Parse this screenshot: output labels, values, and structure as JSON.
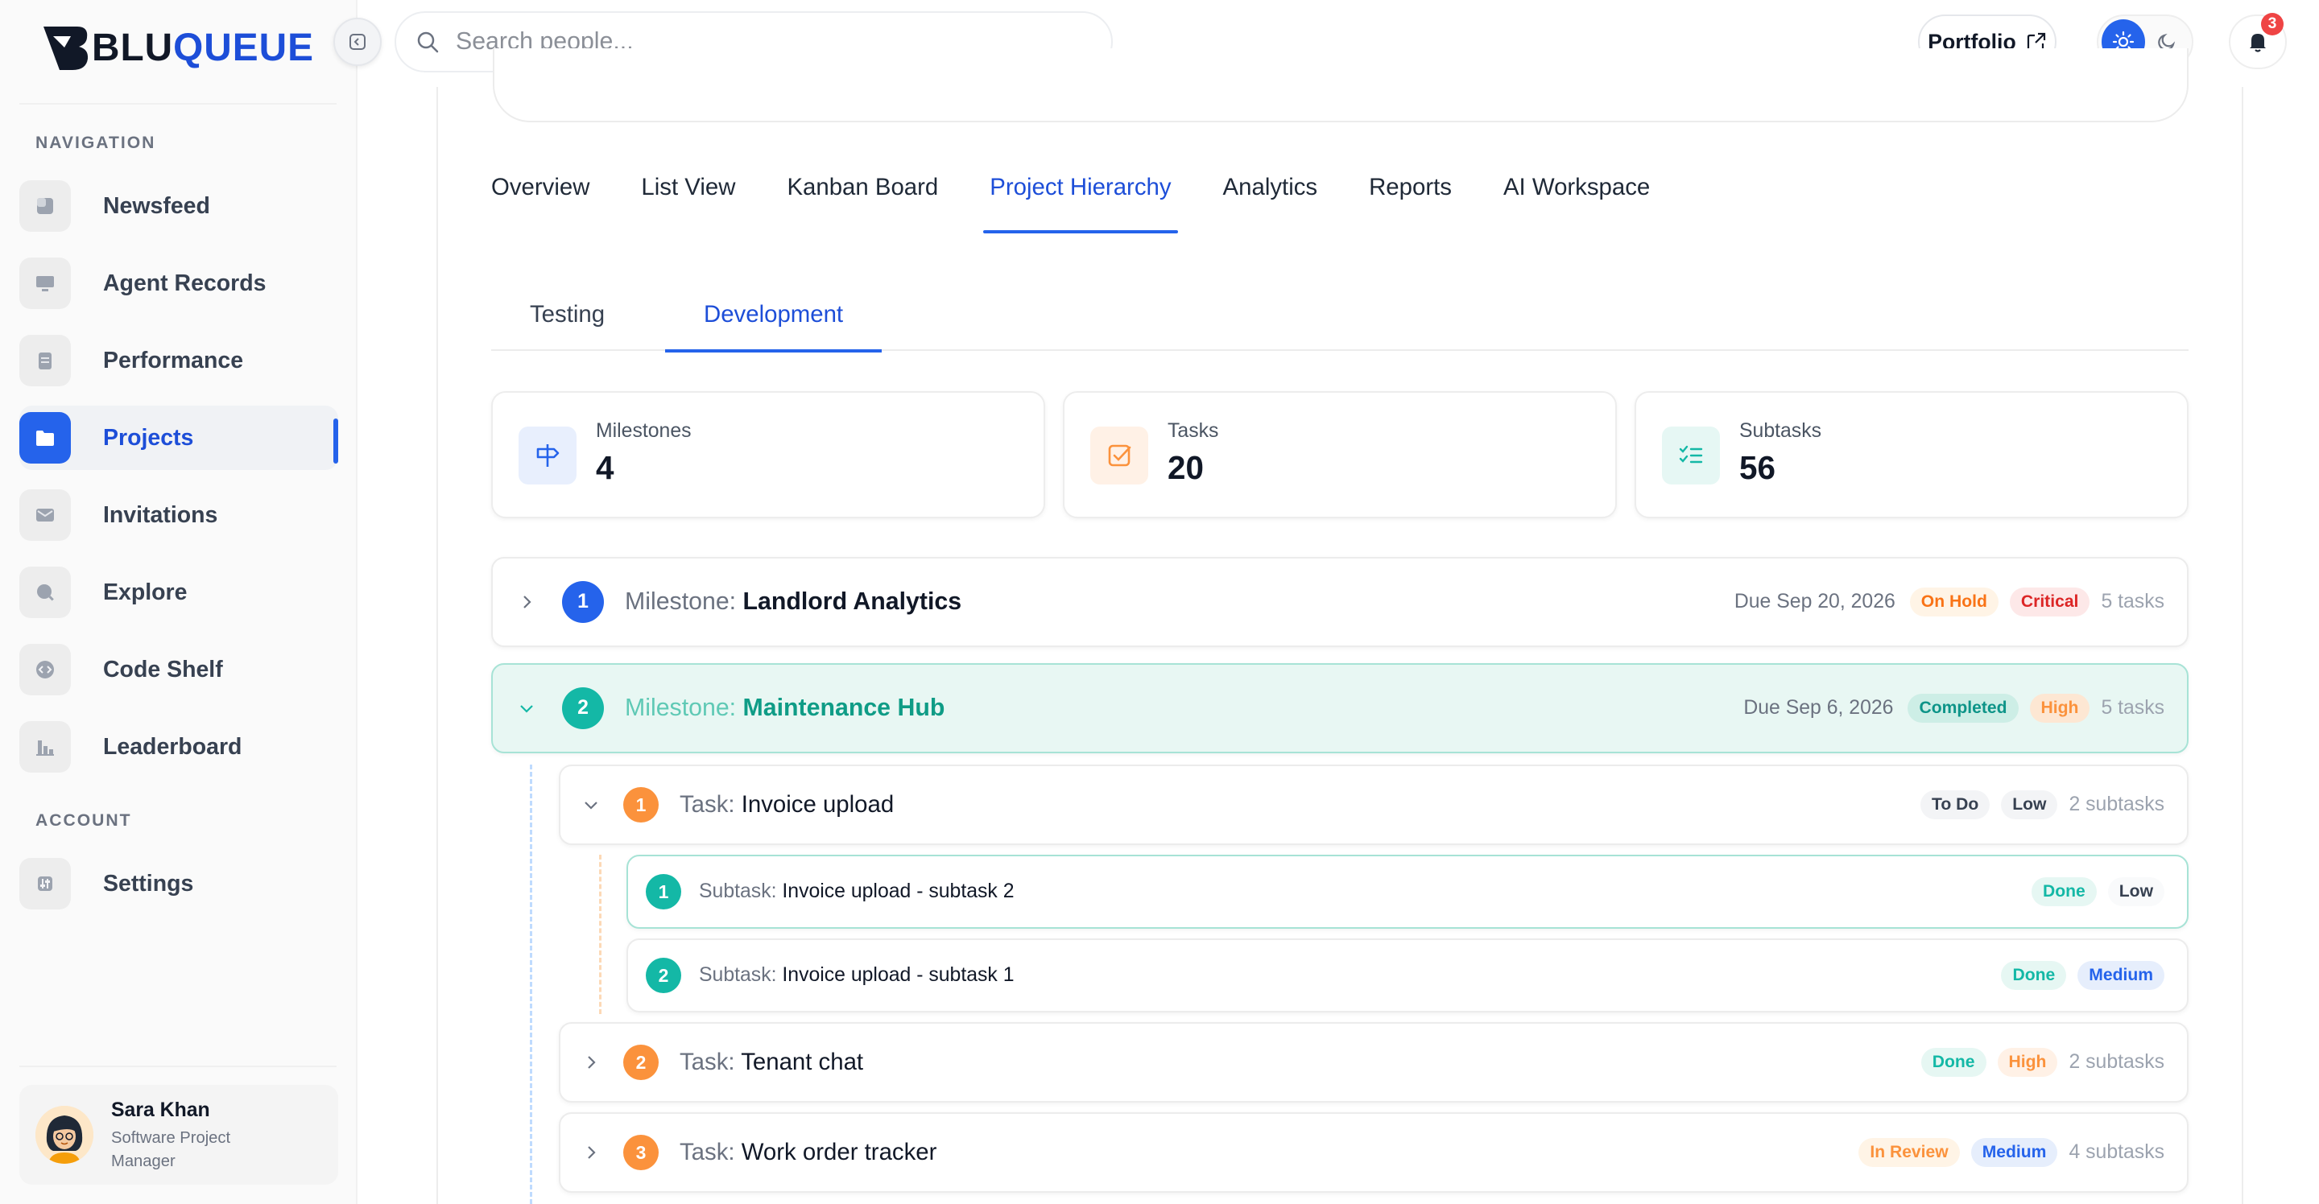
{
  "brand": {
    "logo_text_dark": "BLU",
    "logo_text_blue": "QUEUE",
    "logo_mark_letter": "B"
  },
  "sidebar": {
    "nav_label": "NAVIGATION",
    "account_label": "ACCOUNT",
    "items": [
      {
        "label": "Newsfeed",
        "icon": "newsfeed-icon"
      },
      {
        "label": "Agent Records",
        "icon": "monitor-icon"
      },
      {
        "label": "Performance",
        "icon": "clipboard-icon"
      },
      {
        "label": "Projects",
        "icon": "folder-icon",
        "active": true
      },
      {
        "label": "Invitations",
        "icon": "mail-icon"
      },
      {
        "label": "Explore",
        "icon": "search-icon"
      },
      {
        "label": "Code Shelf",
        "icon": "code-icon"
      },
      {
        "label": "Leaderboard",
        "icon": "bar-chart-icon"
      }
    ],
    "account_items": [
      {
        "label": "Settings",
        "icon": "sliders-icon"
      }
    ]
  },
  "user": {
    "name": "Sara Khan",
    "role": "Software Project Manager"
  },
  "search": {
    "placeholder": "Search people..."
  },
  "header": {
    "portfolio_label": "Portfolio",
    "notification_count": "3"
  },
  "tabs": [
    "Overview",
    "List View",
    "Kanban Board",
    "Project Hierarchy",
    "Analytics",
    "Reports",
    "AI Workspace"
  ],
  "active_tab": "Project Hierarchy",
  "subtabs": [
    "Testing",
    "Development"
  ],
  "active_subtab": "Development",
  "stats": [
    {
      "label": "Milestones",
      "value": "4"
    },
    {
      "label": "Tasks",
      "value": "20"
    },
    {
      "label": "Subtasks",
      "value": "56"
    }
  ],
  "prefix": {
    "milestone": "Milestone:",
    "task": "Task:",
    "subtask": "Subtask:"
  },
  "milestones": [
    {
      "number": "1",
      "name": "Landlord Analytics",
      "due": "Due Sep 20, 2026",
      "status": "On Hold",
      "priority": "Critical",
      "count": "5 tasks",
      "expanded": false
    },
    {
      "number": "2",
      "name": "Maintenance Hub",
      "due": "Due Sep 6, 2026",
      "status": "Completed",
      "priority": "High",
      "count": "5 tasks",
      "expanded": true
    }
  ],
  "tasks": [
    {
      "number": "1",
      "name": "Invoice upload",
      "status": "To Do",
      "priority": "Low",
      "count": "2 subtasks",
      "expanded": true
    },
    {
      "number": "2",
      "name": "Tenant chat",
      "status": "Done",
      "priority": "High",
      "count": "2 subtasks",
      "expanded": false
    },
    {
      "number": "3",
      "name": "Work order tracker",
      "status": "In Review",
      "priority": "Medium",
      "count": "4 subtasks",
      "expanded": false
    }
  ],
  "subtasks": [
    {
      "number": "1",
      "name": "Invoice upload - subtask 2",
      "status": "Done",
      "priority": "Low"
    },
    {
      "number": "2",
      "name": "Invoice upload - subtask 1",
      "status": "Done",
      "priority": "Medium"
    }
  ],
  "colors": {
    "accent": "#2563eb",
    "teal": "#14b8a6",
    "orange": "#fb923c",
    "completed_bg": "#e8f7f3"
  }
}
